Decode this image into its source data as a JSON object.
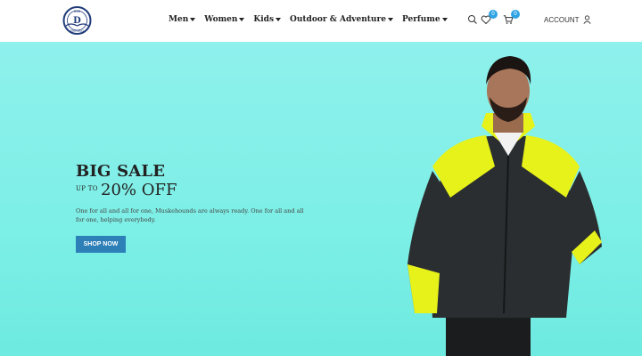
{
  "brand": {
    "logo_top_text": "DSS",
    "logo_letter": "D",
    "logo_bottom_text": "EMPORIO"
  },
  "nav": [
    {
      "label": "Men"
    },
    {
      "label": "Women"
    },
    {
      "label": "Kids"
    },
    {
      "label": "Outdoor & Adventure"
    },
    {
      "label": "Perfume"
    }
  ],
  "header": {
    "wishlist_count": "0",
    "cart_count": "0",
    "account_label": "ACCOUNT",
    "icons": [
      "search-icon",
      "heart-icon",
      "cart-icon",
      "user-icon"
    ]
  },
  "hero": {
    "title": "BIG SALE",
    "upto": "UP TO",
    "discount": "20% OFF",
    "description": "One for all and all for one, Muskehounds are always ready. One for all and all for one, helping everybody.",
    "button_label": "SHOP NOW",
    "background": "#7cefe6",
    "button_color": "#2d7fb8",
    "jacket_colors": [
      "#2b2e30",
      "#e6f21a"
    ]
  }
}
